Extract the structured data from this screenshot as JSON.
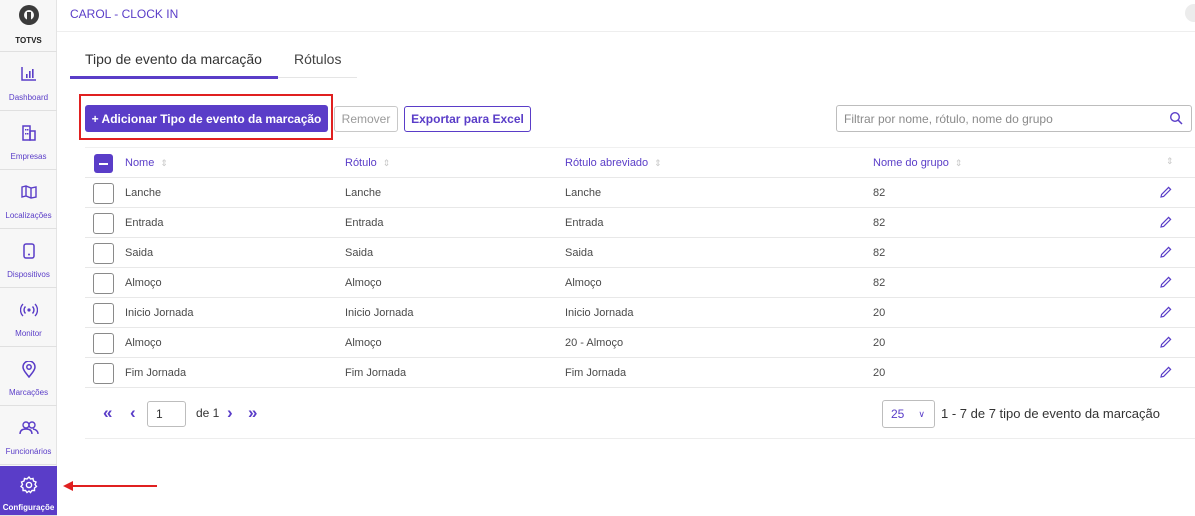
{
  "app": {
    "title": "CAROL - CLOCK IN",
    "logo_text": "TOTVS"
  },
  "sidebar": {
    "items": [
      {
        "label": "Dashboard",
        "icon": "bar-chart-icon"
      },
      {
        "label": "Empresas",
        "icon": "building-icon"
      },
      {
        "label": "Localizações",
        "icon": "map-icon"
      },
      {
        "label": "Dispositivos",
        "icon": "device-icon"
      },
      {
        "label": "Monitor",
        "icon": "broadcast-icon"
      },
      {
        "label": "Marcações",
        "icon": "location-pin-icon"
      },
      {
        "label": "Funcionários",
        "icon": "users-icon"
      },
      {
        "label": "Configuraçõe",
        "icon": "gear-icon",
        "active": true
      }
    ]
  },
  "tabs": [
    {
      "label": "Tipo de evento da marcação",
      "active": true
    },
    {
      "label": "Rótulos",
      "active": false
    }
  ],
  "toolbar": {
    "add_label": "+ Adicionar Tipo de evento da marcação",
    "remove_label": "Remover",
    "export_label": "Exportar para Excel",
    "search_placeholder": "Filtrar por nome, rótulo, nome do grupo"
  },
  "table": {
    "columns": [
      "Nome",
      "Rótulo",
      "Rótulo abreviado",
      "Nome do grupo"
    ],
    "rows": [
      [
        "Lanche",
        "Lanche",
        "Lanche",
        "82"
      ],
      [
        "Entrada",
        "Entrada",
        "Entrada",
        "82"
      ],
      [
        "Saida",
        "Saida",
        "Saida",
        "82"
      ],
      [
        "Almoço",
        "Almoço",
        "Almoço",
        "82"
      ],
      [
        "Inicio Jornada",
        "Inicio Jornada",
        "Inicio Jornada",
        "20"
      ],
      [
        "Almoço",
        "Almoço",
        "20 - Almoço",
        "20"
      ],
      [
        "Fim Jornada",
        "Fim Jornada",
        "Fim Jornada",
        "20"
      ]
    ]
  },
  "pagination": {
    "current_page": "1",
    "of_label": "de 1",
    "per_page": "25",
    "range_text": "1 - 7 de 7 tipo de evento da marcação"
  },
  "colors": {
    "accent": "#5a3dc8",
    "annotation": "#e02020"
  }
}
